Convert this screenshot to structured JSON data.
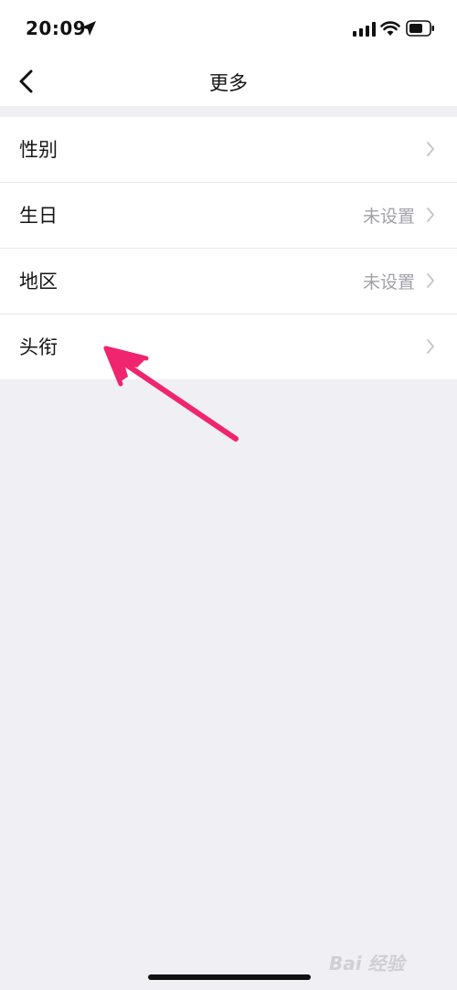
{
  "status_bar": {
    "time": "20:09",
    "icons": [
      "location-arrow-icon",
      "cellular-signal-icon",
      "wifi-icon",
      "battery-icon"
    ]
  },
  "nav": {
    "title": "更多",
    "back_icon": "chevron-left-icon"
  },
  "menu": {
    "items": [
      {
        "label": "性别",
        "value": ""
      },
      {
        "label": "生日",
        "value": "未设置"
      },
      {
        "label": "地区",
        "value": "未设置"
      },
      {
        "label": "头衔",
        "value": ""
      }
    ]
  },
  "annotation": {
    "arrow_color": "#f0246f"
  },
  "watermark": {
    "text": "Bai 经验"
  },
  "colors": {
    "background": "#efeff4",
    "row_value": "#a0a0a8",
    "chevron": "#c4c4c9"
  }
}
